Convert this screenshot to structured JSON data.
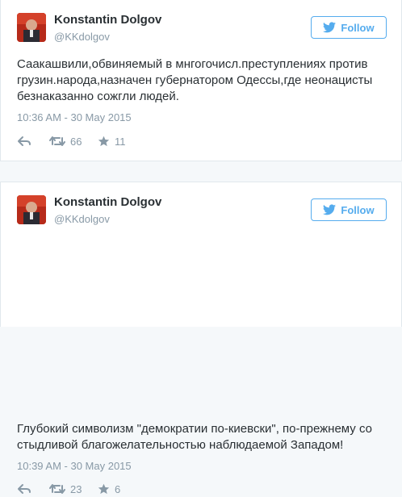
{
  "colors": {
    "accent": "#55acee",
    "muted": "#8899a6",
    "text": "#292f33"
  },
  "tweets": [
    {
      "author_name": "Konstantin Dolgov",
      "author_handle": "@KKdolgov",
      "follow_label": "Follow",
      "text": "Саакашвили,обвиняемый в мнгогочисл.преступлениях против грузин.народа,назначен губернатором Одессы,где неонацисты безнаказанно сожгли людей.",
      "timestamp": "10:36 AM - 30 May 2015",
      "retweets": "66",
      "favorites": "11"
    },
    {
      "author_name": "Konstantin Dolgov",
      "author_handle": "@KKdolgov",
      "follow_label": "Follow",
      "text": "Глубокий символизм \"демократии по-киевски\", по-прежнему со стыдливой благожелательностью наблюдаемой Западом!",
      "timestamp": "10:39 AM - 30 May 2015",
      "retweets": "23",
      "favorites": "6"
    }
  ]
}
